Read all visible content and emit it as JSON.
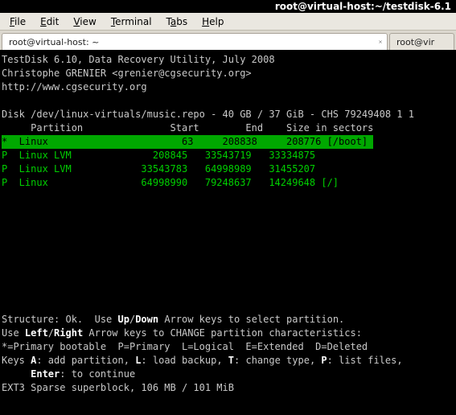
{
  "window": {
    "title": "root@virtual-host:~/testdisk-6.1"
  },
  "menubar": {
    "file": "File",
    "edit": "Edit",
    "view": "View",
    "terminal": "Terminal",
    "tabs": "Tabs",
    "help": "Help"
  },
  "tabs": {
    "active": "root@virtual-host: ~",
    "inactive": "root@vir"
  },
  "app": {
    "banner1": "TestDisk 6.10, Data Recovery Utility, July 2008",
    "banner2": "Christophe GRENIER <grenier@cgsecurity.org>",
    "banner3": "http://www.cgsecurity.org",
    "diskline": "Disk /dev/linux-virtuals/music.repo - 40 GB / 37 GiB - CHS 79249408 1 1",
    "header": "     Partition               Start        End    Size in sectors",
    "rows": [
      "*  Linux                       63     208838     208776 [/boot] ",
      "P  Linux LVM              208845   33543719   33334875",
      "P  Linux LVM            33543783   64998989   31455207",
      "P  Linux                64998990   79248637   14249648 [/]"
    ],
    "help1a": "Structure: Ok.  Use ",
    "help1b": "Up",
    "help1c": "/",
    "help1d": "Down",
    "help1e": " Arrow keys to select partition.",
    "help2a": "Use ",
    "help2b": "Left",
    "help2c": "/",
    "help2d": "Right",
    "help2e": " Arrow keys to CHANGE partition characteristics:",
    "help3": "*=Primary bootable  P=Primary  L=Logical  E=Extended  D=Deleted",
    "keysA": "Keys ",
    "kA": "A",
    "kA2": ": add partition, ",
    "kL": "L",
    "kL2": ": load backup, ",
    "kT": "T",
    "kT2": ": change type, ",
    "kP": "P",
    "kP2": ": list files,",
    "enter1": "     ",
    "enterK": "Enter",
    "enter2": ": to continue",
    "fsline": "EXT3 Sparse superblock, 106 MB / 101 MiB"
  }
}
